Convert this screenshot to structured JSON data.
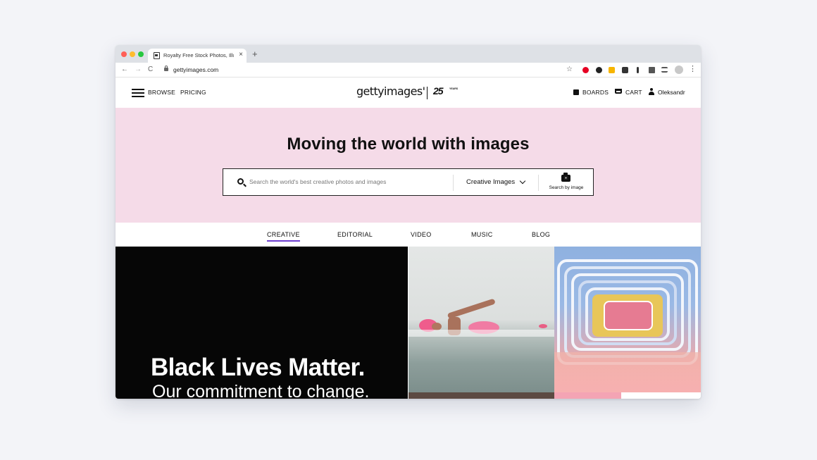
{
  "browser": {
    "tab_title": "Royalty Free Stock Photos, Illu",
    "tab_close": "×",
    "new_tab": "+",
    "url": "gettyimages.com",
    "back": "←",
    "forward": "→",
    "reload": "C",
    "star": "☆",
    "menu": "⋮"
  },
  "header": {
    "browse": "BROWSE",
    "pricing": "PRICING",
    "logo": "gettyimages'",
    "anniversary": "25",
    "anniversary_sub": "YEARS",
    "boards": "BOARDS",
    "cart": "CART",
    "user": "Oleksandr"
  },
  "hero": {
    "title": "Moving the world with images",
    "search_placeholder": "Search the world's best creative photos and images",
    "filter": "Creative Images",
    "search_by_image": "Search by image",
    "background_color": "#f5dbe8"
  },
  "categories": [
    {
      "label": "CREATIVE",
      "active": true
    },
    {
      "label": "EDITORIAL",
      "active": false
    },
    {
      "label": "VIDEO",
      "active": false
    },
    {
      "label": "MUSIC",
      "active": false
    },
    {
      "label": "BLOG",
      "active": false
    }
  ],
  "feature": {
    "title": "Black Lives Matter.",
    "subtitle": "Our commitment to change."
  },
  "colors": {
    "accent": "#6d3fcf"
  }
}
